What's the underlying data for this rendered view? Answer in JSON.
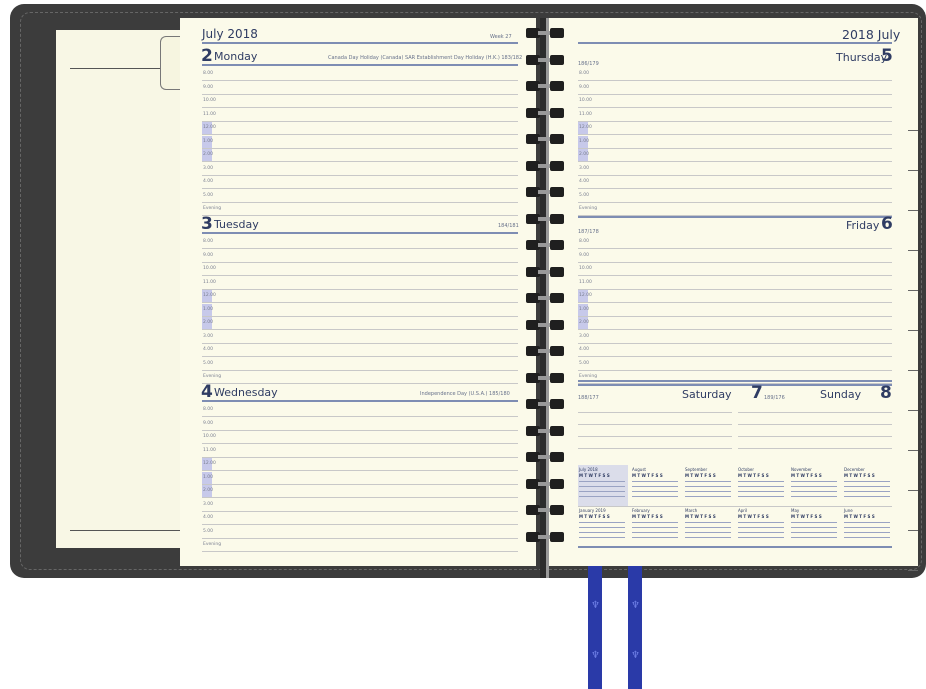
{
  "left_page": {
    "header_title": "July 2018",
    "header_week": "Week 27",
    "days": [
      {
        "num": "2",
        "name": "Monday",
        "notes": "Canada Day Holiday (Canada)  SAR Establishment Day Holiday (H.K.)   183/182",
        "hours": [
          "8.00",
          "9.00",
          "10.00",
          "11.00",
          "12.00",
          "1.00",
          "2.00",
          "3.00",
          "4.00",
          "5.00",
          "Evening"
        ]
      },
      {
        "num": "3",
        "name": "Tuesday",
        "notes": "184/181",
        "hours": [
          "8.00",
          "9.00",
          "10.00",
          "11.00",
          "12.00",
          "1.00",
          "2.00",
          "3.00",
          "4.00",
          "5.00",
          "Evening"
        ]
      },
      {
        "num": "4",
        "name": "Wednesday",
        "notes": "Independence Day (U.S.A.)   185/180",
        "hours": [
          "8.00",
          "9.00",
          "10.00",
          "11.00",
          "12.00",
          "1.00",
          "2.00",
          "3.00",
          "4.00",
          "5.00",
          "Evening"
        ]
      }
    ]
  },
  "right_page": {
    "header_title": "2018 July",
    "days": [
      {
        "num": "5",
        "name": "Thursday",
        "notes": "186/179",
        "hours": [
          "8.00",
          "9.00",
          "10.00",
          "11.00",
          "12.00",
          "1.00",
          "2.00",
          "3.00",
          "4.00",
          "5.00",
          "Evening"
        ]
      },
      {
        "num": "6",
        "name": "Friday",
        "notes": "187/178",
        "hours": [
          "8.00",
          "9.00",
          "10.00",
          "11.00",
          "12.00",
          "1.00",
          "2.00",
          "3.00",
          "4.00",
          "5.00",
          "Evening"
        ]
      }
    ],
    "weekend": {
      "sat_name": "Saturday",
      "sat_num": "7",
      "sat_notes": "188/177",
      "sat_notes2": "189/176",
      "sun_name": "Sunday",
      "sun_num": "8"
    },
    "mini_calendars_row1": [
      "July 2018",
      "August",
      "September",
      "October",
      "November",
      "December"
    ],
    "mini_calendars_row2": [
      "January 2019",
      "February",
      "March",
      "April",
      "May",
      "June"
    ],
    "mini_weekdays": "M T W T F S S"
  }
}
